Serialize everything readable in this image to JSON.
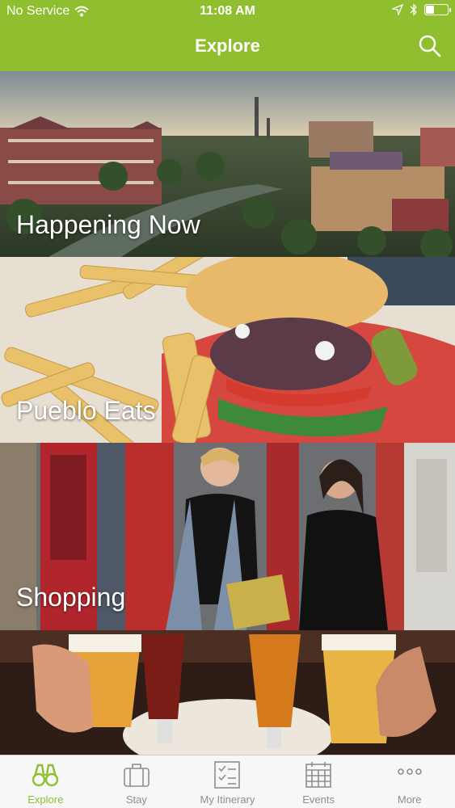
{
  "status_bar": {
    "carrier": "No Service",
    "time": "11:08 AM",
    "battery_level": 0.35
  },
  "header": {
    "title": "Explore",
    "search_icon": "search-icon"
  },
  "tiles": [
    {
      "label": "Happening Now"
    },
    {
      "label": "Pueblo Eats"
    },
    {
      "label": "Shopping"
    },
    {
      "label": ""
    }
  ],
  "tabbar": {
    "active_color": "#8fbf2e",
    "items": [
      {
        "label": "Explore",
        "icon": "binoculars-icon",
        "active": true
      },
      {
        "label": "Stay",
        "icon": "suitcase-icon",
        "active": false
      },
      {
        "label": "My Itinerary",
        "icon": "checklist-icon",
        "active": false
      },
      {
        "label": "Events",
        "icon": "calendar-icon",
        "active": false
      },
      {
        "label": "More",
        "icon": "more-dots-icon",
        "active": false
      }
    ]
  }
}
